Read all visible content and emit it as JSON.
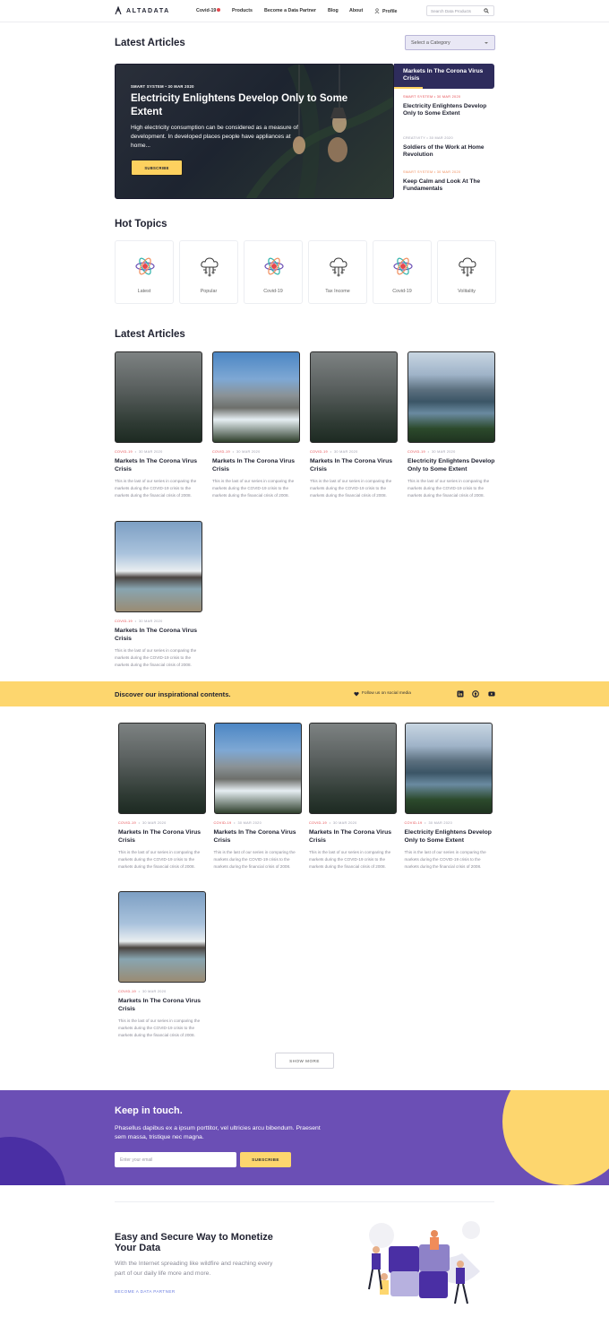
{
  "header": {
    "logo": "ALTADATA",
    "nav": [
      "Covid-19",
      "Products",
      "Become a Data Partner",
      "Blog",
      "About",
      "Profile"
    ],
    "search_placeholder": "Search Data Products"
  },
  "featured": {
    "heading": "Latest Articles",
    "category_select": "Select a Category",
    "hero": {
      "meta": "SMART SYSTEM  •  30 MAR 2020",
      "title": "Electricity Enlightens Develop Only to Some Extent",
      "description": "High electricity consumption can be considered as a measure of development. In developed places people have appliances at home...",
      "button": "SUBSCRIBE"
    },
    "side": [
      {
        "meta": "",
        "title": "Markets In The Corona Virus Crisis"
      },
      {
        "meta": "SMART SYSTEM  •  30 MAR 2020",
        "title": "Electricity Enlightens Develop Only to Some Extent"
      },
      {
        "meta": "CREATIVITY  •  30 MAR 2020",
        "title": "Soldiers of the Work at Home Revolution"
      },
      {
        "meta": "SMART SYSTEM  •  30 MAR 2020",
        "title": "Keep Calm and Look At The Fundamentals"
      }
    ]
  },
  "hot_topics": {
    "heading": "Hot Topics",
    "items": [
      {
        "label": "Latest",
        "icon": "atom-icon"
      },
      {
        "label": "Popular",
        "icon": "cloud-network-icon"
      },
      {
        "label": "Covid-19",
        "icon": "atom-icon"
      },
      {
        "label": "Tax Income",
        "icon": "cloud-network-icon"
      },
      {
        "label": "Covid-19",
        "icon": "atom-icon"
      },
      {
        "label": "Volitality",
        "icon": "cloud-network-icon"
      }
    ]
  },
  "latest": {
    "heading": "Latest Articles",
    "cards": [
      {
        "cat": "COVID-19",
        "date": "30 MAR 2020",
        "title": "Markets In The Corona Virus Crisis",
        "desc": "This is the last of our series in comparing the markets during the COVID-19 crisis to the markets during the financial crisis of 2008.",
        "img": "fog"
      },
      {
        "cat": "COVID-19",
        "date": "30 MAR 2020",
        "title": "Markets In The Corona Virus Crisis",
        "desc": "This is the last of our series in comparing the markets during the COVID-19 crisis to the markets during the financial crisis of 2008.",
        "img": "mtn"
      },
      {
        "cat": "COVID-19",
        "date": "30 MAR 2020",
        "title": "Markets In The Corona Virus Crisis",
        "desc": "This is the last of our series in comparing the markets during the COVID-19 crisis to the markets during the financial crisis of 2008.",
        "img": "fog"
      },
      {
        "cat": "COVID-19",
        "date": "30 MAR 2020",
        "title": "Electricity Enlightens Develop Only to Some Extent",
        "desc": "This is the last of our series in comparing the markets during the COVID-19 crisis to the markets during the financial crisis of 2008.",
        "img": "lake"
      },
      {
        "cat": "COVID-19",
        "date": "30 MAR 2020",
        "title": "Markets In The Corona Virus Crisis",
        "desc": "This is the last of our series in comparing the markets during the COVID-19 crisis to the markets during the financial crisis of 2008.",
        "img": "sea"
      }
    ]
  },
  "band": {
    "title": "Discover our inspirational contents.",
    "follow": "Follow us on social media"
  },
  "more": {
    "cards": [
      {
        "cat": "COVID-19",
        "date": "30 MAR 2020",
        "title": "Markets In The Corona Virus Crisis",
        "desc": "This is the last of our series in comparing the markets during the COVID-19 crisis to the markets during the financial crisis of 2008.",
        "img": "fog"
      },
      {
        "cat": "COVID-19",
        "date": "30 MAR 2020",
        "title": "Markets In The Corona Virus Crisis",
        "desc": "This is the last of our series in comparing the markets during the COVID-19 crisis to the markets during the financial crisis of 2008.",
        "img": "mtn"
      },
      {
        "cat": "COVID-19",
        "date": "30 MAR 2020",
        "title": "Markets In The Corona Virus Crisis",
        "desc": "This is the last of our series in comparing the markets during the COVID-19 crisis to the markets during the financial crisis of 2008.",
        "img": "fog"
      },
      {
        "cat": "COVID-19",
        "date": "30 MAR 2020",
        "title": "Electricity Enlightens Develop Only to Some Extent",
        "desc": "This is the last of our series in comparing the markets during the COVID-19 crisis to the markets during the financial crisis of 2008.",
        "img": "lake"
      },
      {
        "cat": "COVID-19",
        "date": "30 MAR 2020",
        "title": "Markets In The Corona Virus Crisis",
        "desc": "This is the last of our series in comparing the markets during the COVID-19 crisis to the markets during the financial crisis of 2008.",
        "img": "sea"
      }
    ],
    "show_more": "SHOW MORE"
  },
  "newsletter": {
    "title": "Keep in touch.",
    "description": "Phasellus dapibus ex a ipsum porttitor, vel ultricies arcu bibendum. Praesent sem massa, tristique nec magna.",
    "email_placeholder": "Enter your email",
    "button": "SUBSCRIBE"
  },
  "cta": {
    "title": "Easy and Secure Way to Monetize Your Data",
    "description": "With the Internet spreading like wildfire and reaching every part of our daily life more and more.",
    "link": "BECOME A DATA PARTNER"
  },
  "colors": {
    "accent_yellow": "#fdd66e",
    "purple": "#6b4fb5",
    "navy": "#2e2c5c",
    "red": "#e5484d"
  }
}
